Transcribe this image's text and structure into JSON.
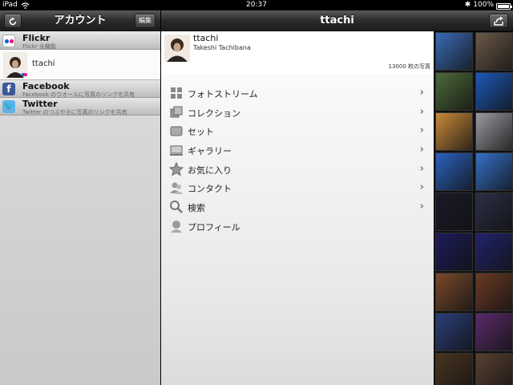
{
  "status_bar": {
    "device": "iPad",
    "time": "20:37",
    "battery": "100%",
    "battery_level": 1.0
  },
  "left_pane": {
    "title": "アカウント",
    "edit_label": "編集",
    "refresh_icon": "refresh-icon",
    "accounts": [
      {
        "name": "Flickr",
        "sub": "Flickr 全機能",
        "icon": "flickr-icon"
      },
      {
        "name": "Facebook",
        "sub": "Facebook のウオールに写真のリンクを共有",
        "icon": "facebook-icon"
      },
      {
        "name": "Twitter",
        "sub": "Twitter のつぶやきに写真のリンクを共有",
        "icon": "twitter-icon"
      }
    ],
    "user": {
      "name": "ttachi"
    }
  },
  "center_pane": {
    "title": "ttachi",
    "share_icon": "share-icon",
    "profile": {
      "username": "ttachi",
      "fullname": "Takeshi Tachibana",
      "count": "13000 枚の写真"
    },
    "menu": [
      {
        "label": "フォトストリーム",
        "icon": "photostream-icon",
        "chevron": "›"
      },
      {
        "label": "コレクション",
        "icon": "collection-icon",
        "chevron": "›"
      },
      {
        "label": "セット",
        "icon": "set-icon",
        "chevron": "›"
      },
      {
        "label": "ギャラリー",
        "icon": "gallery-icon",
        "chevron": "›"
      },
      {
        "label": "お気に入り",
        "icon": "star-icon",
        "chevron": "›"
      },
      {
        "label": "コンタクト",
        "icon": "contacts-icon",
        "chevron": "›"
      },
      {
        "label": "検索",
        "icon": "search-icon",
        "chevron": "›"
      },
      {
        "label": "プロフィール",
        "icon": "profile-icon",
        "chevron": ""
      }
    ]
  },
  "thumbnails": {
    "colors": [
      [
        "#3a6bb5",
        "#6b5a48"
      ],
      [
        "#4c6a3a",
        "#1d58b8"
      ],
      [
        "#c98a3a",
        "#9a9aa0"
      ],
      [
        "#2c62c0",
        "#3570c8"
      ],
      [
        "#1a1a2a",
        "#2a2f45"
      ],
      [
        "#1c1c5a",
        "#20246a"
      ],
      [
        "#7a4a2a",
        "#6a3a25"
      ],
      [
        "#2a3f7a",
        "#5a2a6a"
      ],
      [
        "#4a3520",
        "#5a4030"
      ]
    ]
  }
}
